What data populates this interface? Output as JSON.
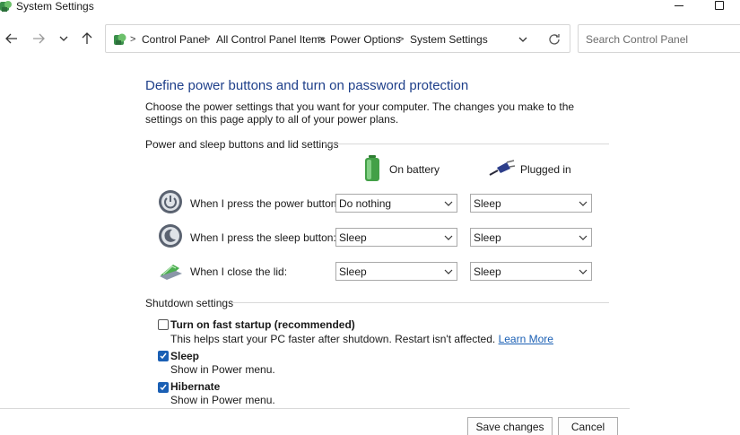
{
  "window": {
    "title": "System Settings",
    "icon": "control-panel-icon"
  },
  "address_bar": {
    "icon": "control-panel-icon",
    "breadcrumbs": [
      "Control Panel",
      "All Control Panel Items",
      "Power Options",
      "System Settings"
    ],
    "separator": ">"
  },
  "search": {
    "placeholder": "Search Control Panel"
  },
  "page": {
    "heading": "Define power buttons and turn on password protection",
    "description": "Choose the power settings that you want for your computer. The changes you make to the settings on this page apply to all of your power plans."
  },
  "buttons_section": {
    "title": "Power and sleep buttons and lid settings",
    "columns": {
      "battery": "On battery",
      "plugged": "Plugged in"
    },
    "rows": [
      {
        "label": "When I press the power button:",
        "icon": "power-button-icon",
        "battery": "Do nothing",
        "plugged": "Sleep"
      },
      {
        "label": "When I press the sleep button:",
        "icon": "sleep-button-icon",
        "battery": "Sleep",
        "plugged": "Sleep"
      },
      {
        "label": "When I close the lid:",
        "icon": "laptop-lid-icon",
        "battery": "Sleep",
        "plugged": "Sleep"
      }
    ]
  },
  "shutdown_section": {
    "title": "Shutdown settings",
    "items": [
      {
        "label": "Turn on fast startup (recommended)",
        "checked": false,
        "sub": "This helps start your PC faster after shutdown. Restart isn't affected.",
        "link": "Learn More"
      },
      {
        "label": "Sleep",
        "checked": true,
        "sub": "Show in Power menu."
      },
      {
        "label": "Hibernate",
        "checked": true,
        "sub": "Show in Power menu."
      }
    ]
  },
  "footer": {
    "save": "Save changes",
    "cancel": "Cancel"
  },
  "colors": {
    "heading": "#1e3f8a",
    "link": "#1a5fb4",
    "checkbox": "#1a5fb4"
  }
}
